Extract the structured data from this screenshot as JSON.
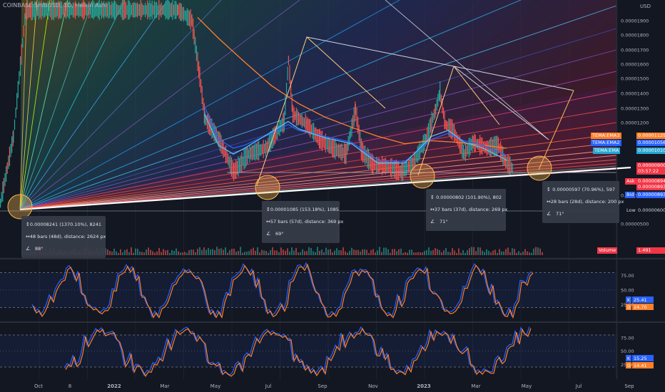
{
  "header": {
    "symbol_line": "COINBASE:SHIBUSD, 1D, Heikin Ashi",
    "currency": "USD"
  },
  "chart_data": [
    {
      "type": "line",
      "title": "COINBASE:SHIBUSD, 1D, Heikin Ashi",
      "x_tick_labels": [
        "Oct",
        "8",
        "2022",
        "Mar",
        "May",
        "Jul",
        "Sep",
        "Nov",
        "2023",
        "Mar",
        "May",
        "Jul",
        "Sep"
      ],
      "y_tick_labels": [
        "0.00001900",
        "0.00001800",
        "0.00001700",
        "0.00001600",
        "0.00001500",
        "0.00001400",
        "0.00001300",
        "0.00001200",
        "0.00000700",
        "0.00000500"
      ],
      "ylim": [
        4e-06,
        2.05e-05
      ],
      "grid": true,
      "series": [
        {
          "name": "TEMA:EMA3",
          "color": "#ff7f2a",
          "x": [
            "2022-05-08",
            "2022-06-01",
            "2022-07-01",
            "2022-08-01",
            "2022-09-01",
            "2022-10-01",
            "2022-11-01",
            "2022-12-01",
            "2023-01-01",
            "2023-02-01",
            "2023-03-01",
            "2023-04-01",
            "2023-04-28"
          ],
          "values": [
            2e-05,
            1.86e-05,
            1.7e-05,
            1.54e-05,
            1.42e-05,
            1.33e-05,
            1.26e-05,
            1.2e-05,
            1.15e-05,
            1.17e-05,
            1.16e-05,
            1.14e-05,
            1.12e-05
          ]
        },
        {
          "name": "TEMA:EMA2",
          "color": "#2962ff",
          "x": [
            "2022-05-16",
            "2022-06-01",
            "2022-06-18",
            "2022-07-01",
            "2022-08-01",
            "2022-08-20",
            "2022-09-01",
            "2022-10-01",
            "2022-11-01",
            "2022-12-01",
            "2023-01-01",
            "2023-02-01",
            "2023-02-20",
            "2023-03-10",
            "2023-04-01",
            "2023-04-28"
          ],
          "values": [
            1.4e-05,
            1.18e-05,
            1.12e-05,
            1.14e-05,
            1.22e-05,
            1.28e-05,
            1.24e-05,
            1.2e-05,
            1.16e-05,
            1.04e-05,
            1.03e-05,
            1.18e-05,
            1.22e-05,
            1.17e-05,
            1.14e-05,
            1.07e-05
          ]
        },
        {
          "name": "TEMA:EMA",
          "color": "#4fc3f7",
          "x": [
            "2022-05-16",
            "2022-06-01",
            "2022-06-18",
            "2022-07-01",
            "2022-08-01",
            "2022-08-20",
            "2022-09-01",
            "2022-10-01",
            "2022-11-01",
            "2022-12-01",
            "2023-01-01",
            "2023-02-01",
            "2023-02-20",
            "2023-03-10",
            "2023-04-01",
            "2023-04-28"
          ],
          "values": [
            1.35e-05,
            1.14e-05,
            1.08e-05,
            1.12e-05,
            1.23e-05,
            1.3e-05,
            1.25e-05,
            1.19e-05,
            1.15e-05,
            1.02e-05,
            1.02e-05,
            1.2e-05,
            1.24e-05,
            1.16e-05,
            1.12e-05,
            1.04e-05
          ]
        }
      ],
      "price_tags": [
        {
          "label": "TEMA:EMA3",
          "value": "0.00001129",
          "color": "#ff7f2a"
        },
        {
          "label": "TEMA:EMA2",
          "value": "0.00001056",
          "color": "#2962ff"
        },
        {
          "label": "TEMA:EMA",
          "value": "0.00001010",
          "color": "#26a6d1"
        },
        {
          "label": "",
          "value": "0.00000900",
          "color": "#f23645"
        },
        {
          "label": "",
          "value": "03:57:22",
          "color": "#f23645"
        },
        {
          "label": "Ask",
          "value": "0.00000894",
          "color": "#f23645"
        },
        {
          "label": "",
          "value": "0.00000893",
          "color": "#f23645"
        },
        {
          "label": "Bid",
          "value": "0.00000893",
          "color": "#2962ff"
        },
        {
          "label": "Low",
          "value": "0.00000600",
          "color": "#131722"
        },
        {
          "label": "Volume",
          "value": "1.491",
          "color": "#f23645"
        }
      ],
      "measurements": [
        {
          "price": "0.00008241 (1370.10%), 8241",
          "bars": "48 bars (48d), distance: 2624 px",
          "angle": "88°"
        },
        {
          "price": "0.00001085 (153.18%), 1085",
          "bars": "57 bars (57d), distance: 369 px",
          "angle": "69°"
        },
        {
          "price": "0.00000802 (101.90%), 802",
          "bars": "37 bars (37d), distance: 269 px",
          "angle": "71°"
        },
        {
          "price": "0.00000597 (70.96%), 597",
          "bars": "28 bars (28d), distance: 200 px",
          "angle": "71°"
        }
      ],
      "colors": {
        "background": "#131722",
        "candle_up": "#26a69a",
        "candle_down": "#ef5350",
        "trendline": "#ffffff",
        "triangle": "#ffb74d"
      }
    },
    {
      "type": "line",
      "title": "",
      "ylim": [
        0,
        100
      ],
      "y_tick_labels": [
        "75.00",
        "50.00",
        "25.00"
      ],
      "levels": [
        80,
        20
      ],
      "series": [
        {
          "name": "K",
          "color": "#2962ff",
          "value": "25.41"
        },
        {
          "name": "D",
          "color": "#ff7f2a",
          "value": "24.70"
        }
      ]
    },
    {
      "type": "line",
      "title": "",
      "ylim": [
        0,
        100
      ],
      "y_tick_labels": [
        "75.00",
        "50.00",
        "25.00"
      ],
      "levels": [
        80,
        20
      ],
      "series": [
        {
          "name": "K",
          "color": "#2962ff",
          "value": "15.25"
        },
        {
          "name": "D",
          "color": "#ff7f2a",
          "value": "14.41"
        }
      ]
    }
  ]
}
